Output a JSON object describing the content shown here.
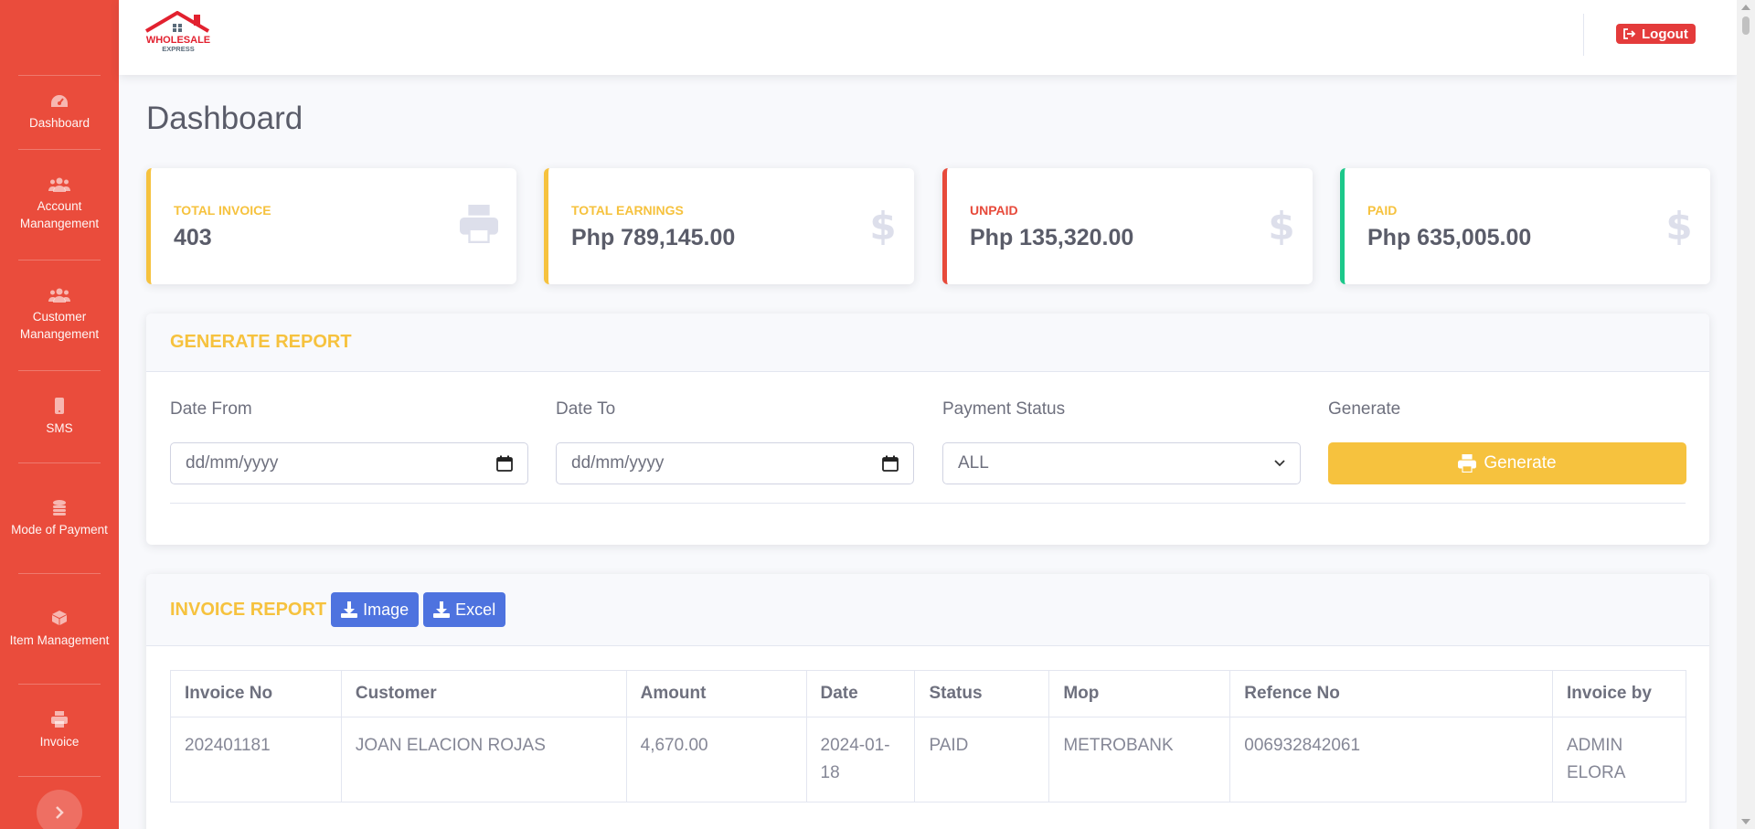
{
  "sidebar": {
    "items": [
      {
        "label": "Dashboard",
        "icon": "tachometer-icon"
      },
      {
        "label": "Account Manangement",
        "icon": "users-icon"
      },
      {
        "label": "Customer Manangement",
        "icon": "users-icon"
      },
      {
        "label": "SMS",
        "icon": "mobile-icon"
      },
      {
        "label": "Mode of Payment",
        "icon": "coins-icon"
      },
      {
        "label": "Item Management",
        "icon": "box-icon"
      },
      {
        "label": "Invoice",
        "icon": "print-icon"
      }
    ]
  },
  "topbar": {
    "logo_text": "WHOLESALE",
    "logo_subtext": "EXPRESS",
    "logout_label": "Logout"
  },
  "page": {
    "title": "Dashboard"
  },
  "stats": [
    {
      "label": "TOTAL INVOICE",
      "value": "403",
      "color": "#f6c23e",
      "icon": "print-icon"
    },
    {
      "label": "TOTAL EARNINGS",
      "value": "Php 789,145.00",
      "color": "#f6c23e",
      "icon": "dollar-icon"
    },
    {
      "label": "UNPAID",
      "value": "Php 135,320.00",
      "color": "#e74a3b",
      "icon": "dollar-icon"
    },
    {
      "label": "PAID",
      "value": "Php 635,005.00",
      "color": "#1cc88a",
      "icon": "dollar-icon"
    }
  ],
  "report": {
    "title": "GENERATE REPORT",
    "date_from_label": "Date From",
    "date_from_placeholder": "dd/mm/yyyy",
    "date_to_label": "Date To",
    "date_to_placeholder": "dd/mm/yyyy",
    "status_label": "Payment Status",
    "status_selected": "ALL",
    "generate_label": "Generate",
    "generate_button": "Generate"
  },
  "invoice_report": {
    "title": "INVOICE REPORT",
    "image_button": "Image",
    "excel_button": "Excel",
    "columns": [
      "Invoice No",
      "Customer",
      "Amount",
      "Date",
      "Status",
      "Mop",
      "Refence No",
      "Invoice by"
    ],
    "rows": [
      [
        "202401181",
        "JOAN ELACION ROJAS",
        "4,670.00",
        "2024-01-18",
        "PAID",
        "METROBANK",
        "006932842061",
        "ADMIN ELORA"
      ]
    ]
  },
  "colors": {
    "sidebar": "#ea4c3c",
    "warning": "#f6c23e",
    "danger": "#e74a3b",
    "success": "#1cc88a",
    "primary": "#4e73df"
  }
}
